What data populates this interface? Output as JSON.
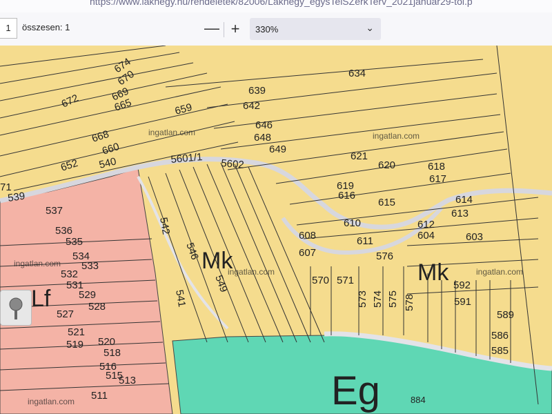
{
  "browser": {
    "url": "https://www.lakhegy.hu/rendeletek/82006/Lakhegy_egysTelSZerkTerv_2021januar29-tol.p"
  },
  "viewer": {
    "page_number": "1",
    "total_label": "összesen: 1",
    "zoom_out": "—",
    "zoom_in": "+",
    "zoom_value": "330%",
    "chevron": "⌄"
  },
  "map": {
    "zones": {
      "mk1": "Mk",
      "mk2": "Mk",
      "lf": "Lf",
      "eg": "Eg"
    },
    "road_number": "884",
    "watermarks": [
      "ingatlan.com",
      "ingatlan.com",
      "ingatlan.com",
      "ingatlan.com",
      "ingatlan.com",
      "ingatlan.com"
    ],
    "colors": {
      "yellow": "#f5dc8e",
      "pink": "#f4b3a6",
      "green": "#5fd7b4",
      "road": "#d7d7de",
      "line": "#333333"
    },
    "parcels": {
      "p674": "674",
      "p670": "670",
      "p672": "672",
      "p669": "669",
      "p665": "665",
      "p659": "659",
      "p634": "634",
      "p639": "639",
      "p642": "642",
      "p646": "646",
      "p648": "648",
      "p649": "649",
      "p621": "621",
      "p620": "620",
      "p618": "618",
      "p617": "617",
      "p619": "619",
      "p616": "616",
      "p615": "615",
      "p614": "614",
      "p613": "613",
      "p612": "612",
      "p610": "610",
      "p611": "611",
      "p604": "604",
      "p603": "603",
      "p608": "608",
      "p607": "607",
      "p576": "576",
      "p570": "570",
      "p571": "571",
      "p573": "573",
      "p574": "574",
      "p575": "575",
      "p578": "578",
      "p592": "592",
      "p591": "591",
      "p589": "589",
      "p586": "586",
      "p585": "585",
      "p652": "652",
      "p668": "668",
      "p660": "660",
      "p540": "540",
      "p560": "5601/1",
      "p5602": "5602",
      "p539": "539",
      "p537": "537",
      "p536": "536",
      "p535": "535",
      "p534": "534",
      "p533": "533",
      "p532": "532",
      "p531": "531",
      "p529": "529",
      "p528": "528",
      "p527": "527",
      "p521": "521",
      "p519": "519",
      "p520": "520",
      "p518": "518",
      "p516": "516",
      "p515": "515",
      "p513": "513",
      "p511": "511",
      "p542": "542",
      "p541": "541",
      "p71": "71",
      "p546": "546",
      "p549": "549"
    }
  }
}
